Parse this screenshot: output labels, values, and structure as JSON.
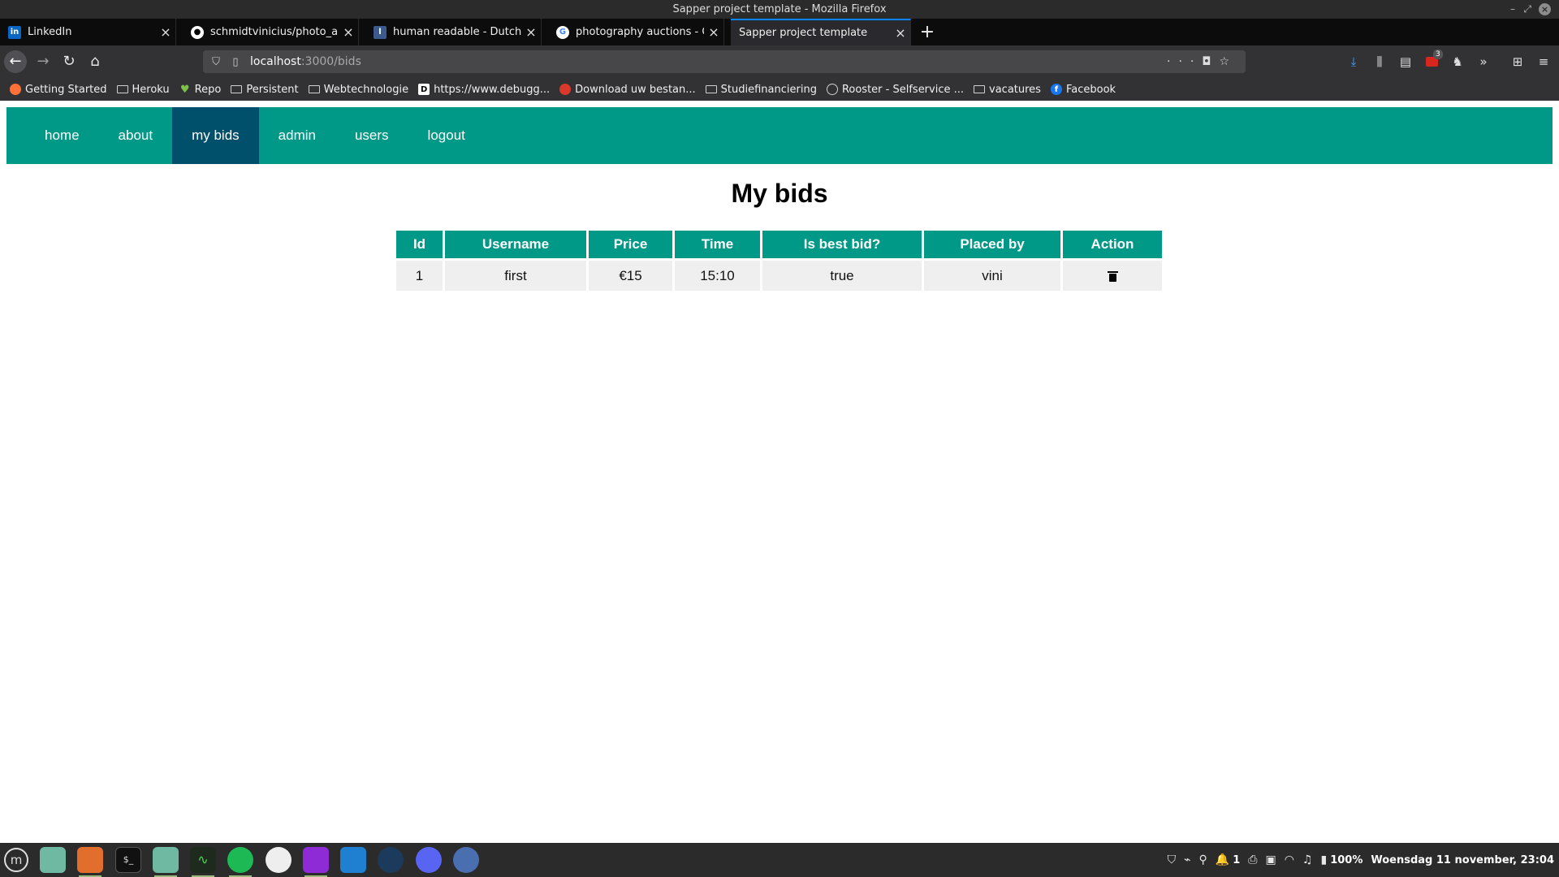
{
  "window": {
    "title": "Sapper project template - Mozilla Firefox"
  },
  "tabs": [
    {
      "label": "LinkedIn",
      "icon": "linkedin-icon"
    },
    {
      "label": "schmidtvinicius/photo_auc",
      "icon": "github-icon"
    },
    {
      "label": "human readable - Dutch tra",
      "icon": "dictionary-icon"
    },
    {
      "label": "photography auctions - Goo",
      "icon": "google-icon"
    },
    {
      "label": "Sapper project template",
      "icon": ""
    }
  ],
  "url": {
    "host": "localhost",
    "path": ":3000/bids"
  },
  "bookmarks": [
    {
      "label": "Getting Started",
      "icon": "firefox-icon"
    },
    {
      "label": "Heroku",
      "icon": "folder-icon"
    },
    {
      "label": "Repo",
      "icon": "leaf-icon"
    },
    {
      "label": "Persistent",
      "icon": "folder-icon"
    },
    {
      "label": "Webtechnologie",
      "icon": "folder-icon"
    },
    {
      "label": "https://www.debugg...",
      "icon": "debug-icon"
    },
    {
      "label": "Download uw bestan...",
      "icon": "download-site-icon"
    },
    {
      "label": "Studiefinanciering",
      "icon": "folder-icon"
    },
    {
      "label": "Rooster - Selfservice ...",
      "icon": "globe-icon"
    },
    {
      "label": "vacatures",
      "icon": "folder-icon"
    },
    {
      "label": "Facebook",
      "icon": "facebook-icon"
    }
  ],
  "site_nav": [
    {
      "label": "home",
      "active": false
    },
    {
      "label": "about",
      "active": false
    },
    {
      "label": "my bids",
      "active": true
    },
    {
      "label": "admin",
      "active": false
    },
    {
      "label": "users",
      "active": false
    },
    {
      "label": "logout",
      "active": false
    }
  ],
  "page_title": "My bids",
  "table": {
    "headers": [
      "Id",
      "Username",
      "Price",
      "Time",
      "Is best bid?",
      "Placed by",
      "Action"
    ],
    "rows": [
      {
        "id": "1",
        "username": "first",
        "price": "€15",
        "time": "15:10",
        "is_best": "true",
        "placed_by": "vini",
        "action": "trash-icon"
      }
    ]
  },
  "toolbar": {
    "badge_count": "3"
  },
  "tray": {
    "notif_count": "1",
    "battery": "100%",
    "datetime": "Woensdag 11 november, 23:04"
  },
  "colors": {
    "accent": "#009987",
    "active_nav": "#00506b",
    "firefox_blue": "#0a84ff"
  }
}
